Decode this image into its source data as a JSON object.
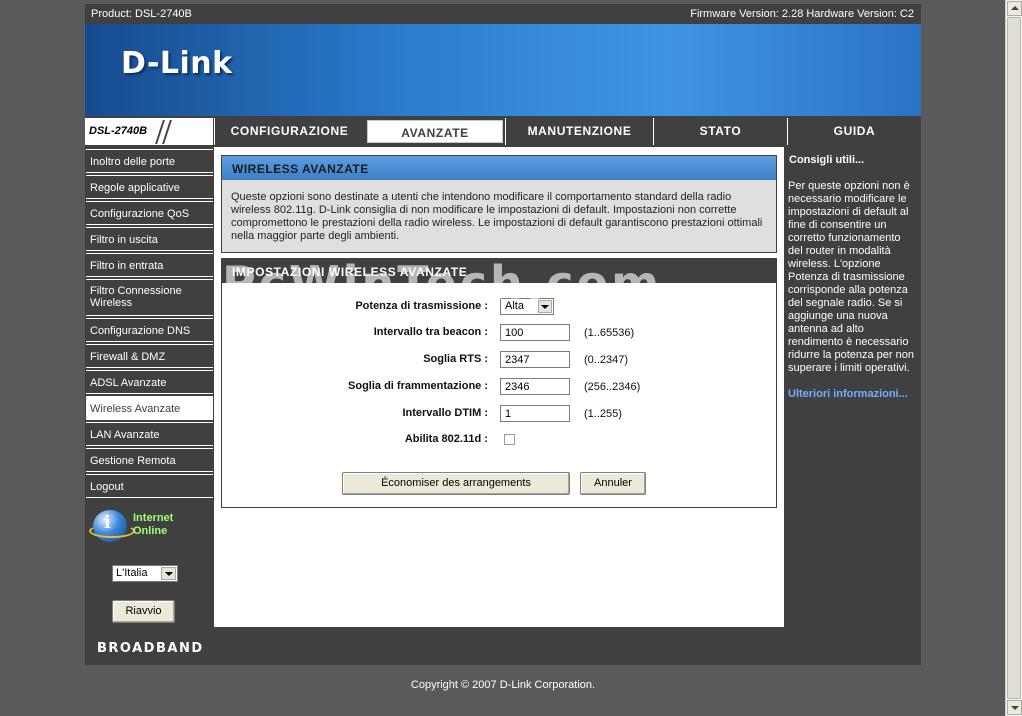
{
  "header": {
    "product": "Product: DSL-2740B",
    "versions": "Firmware Version: 2.28 Hardware Version: C2",
    "logo": "D-Link",
    "model": "DSL-2740B"
  },
  "tabs": [
    {
      "label": "CONFIGURAZIONE"
    },
    {
      "label": "AVANZATE"
    },
    {
      "label": "MANUTENZIONE"
    },
    {
      "label": "STATO"
    },
    {
      "label": "GUIDA"
    }
  ],
  "sidebar": {
    "items": [
      {
        "label": "Inoltro delle porte"
      },
      {
        "label": "Regole applicative"
      },
      {
        "label": "Configurazione QoS"
      },
      {
        "label": "Filtro in uscita"
      },
      {
        "label": "Filtro in entrata"
      },
      {
        "label": "Filtro Connessione Wireless"
      },
      {
        "label": "Configurazione DNS"
      },
      {
        "label": "Firewall & DMZ"
      },
      {
        "label": "ADSL Avanzate"
      },
      {
        "label": "Wireless Avanzate"
      },
      {
        "label": "LAN Avanzate"
      },
      {
        "label": "Gestione Remota"
      },
      {
        "label": "Logout"
      }
    ],
    "status_line1": "Internet",
    "status_line2": "Online",
    "language": "L'Italia",
    "reboot_label": "Riavvio"
  },
  "main": {
    "section_title": "WIRELESS AVANZATE",
    "description": "Queste opzioni sono destinate a utenti che intendono modificare il comportamento standard della radio wireless 802.11g. D-Link consiglia di non modificare le impostazioni di default. Impostazioni non corrette compromettono le prestazioni della radio wireless. Le impostazioni di default garantiscono prestazioni ottimali nella maggior parte degli ambienti.",
    "settings_title": "IMPOSTAZIONI WIRELESS AVANZATE",
    "watermark": "PcWinTech.com",
    "fields": {
      "power_label": "Potenza di trasmissione :",
      "power_value": "Alta",
      "beacon_label": "Intervallo tra beacon :",
      "beacon_value": "100",
      "beacon_range": "(1..65536)",
      "rts_label": "Soglia RTS :",
      "rts_value": "2347",
      "rts_range": "(0..2347)",
      "frag_label": "Soglia di frammentazione :",
      "frag_value": "2346",
      "frag_range": "(256..2346)",
      "dtim_label": "Intervallo DTIM :",
      "dtim_value": "1",
      "dtim_range": "(1..255)",
      "d_label": "Abilita 802.11d :"
    },
    "save_label": "Économiser des arrangements",
    "cancel_label": "Annuler"
  },
  "help": {
    "title": "Consigli utili...",
    "text": "Per queste opzioni non è necessario modificare le impostazioni di default al fine di consentire un corretto funzionamento del router in modalità wireless. L'opzione Potenza di trasmissione corrisponde alla potenza del segnale radio. Se si aggiunge una nuova antenna ad alto rendimento è necessario ridurre la potenza per non superare i limiti operativi.",
    "more": "Ulteriori informazioni..."
  },
  "footer": {
    "brand": "BROADBAND",
    "copyright": "Copyright © 2007 D-Link Corporation."
  }
}
